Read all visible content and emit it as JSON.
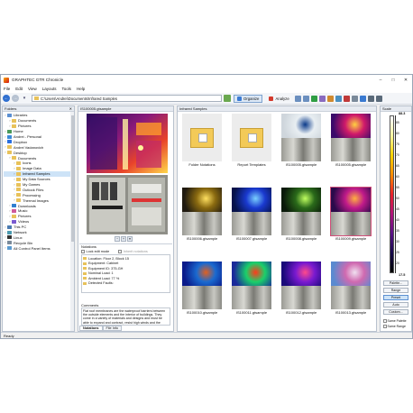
{
  "window": {
    "title": "GRAPHTEC GTR Chronicle"
  },
  "menu": [
    "File",
    "Edit",
    "View",
    "Layouts",
    "Tools",
    "Help"
  ],
  "address": {
    "path": "C:\\Users\\Andrei\\Documents\\Infrared Samples"
  },
  "toolbar": {
    "organize": "Organize",
    "analyze": "Analyze"
  },
  "folders": {
    "header": "Folders",
    "items": [
      {
        "label": "Libraries",
        "indent": 0,
        "icon": "library-icon"
      },
      {
        "label": "Documents",
        "indent": 1,
        "icon": "folder-icon"
      },
      {
        "label": "Pictures",
        "indent": 1,
        "icon": "folder-icon"
      },
      {
        "label": "Home",
        "indent": 0,
        "icon": "home-icon"
      },
      {
        "label": "Andrei - Personal",
        "indent": 0,
        "icon": "cloud-icon"
      },
      {
        "label": "Dropbox",
        "indent": 0,
        "icon": "dropbox-icon"
      },
      {
        "label": "Andrei Vadanovich",
        "indent": 0,
        "icon": "user-folder-icon"
      },
      {
        "label": "Desktop",
        "indent": 0,
        "icon": "folder-icon"
      },
      {
        "label": "Documents",
        "indent": 1,
        "icon": "folder-icon"
      },
      {
        "label": "Icons",
        "indent": 2,
        "icon": "folder-icon"
      },
      {
        "label": "Image Data",
        "indent": 2,
        "icon": "folder-icon"
      },
      {
        "label": "Infrared Samples",
        "indent": 2,
        "icon": "folder-icon",
        "selected": true
      },
      {
        "label": "My Data Sources",
        "indent": 2,
        "icon": "folder-icon"
      },
      {
        "label": "My Games",
        "indent": 2,
        "icon": "folder-icon"
      },
      {
        "label": "Outlook Files",
        "indent": 2,
        "icon": "folder-icon"
      },
      {
        "label": "Processing",
        "indent": 2,
        "icon": "folder-icon"
      },
      {
        "label": "Thermal Images",
        "indent": 2,
        "icon": "folder-icon"
      },
      {
        "label": "Downloads",
        "indent": 1,
        "icon": "download-icon"
      },
      {
        "label": "Music",
        "indent": 1,
        "icon": "music-icon"
      },
      {
        "label": "Pictures",
        "indent": 1,
        "icon": "folder-icon"
      },
      {
        "label": "Videos",
        "indent": 1,
        "icon": "video-icon"
      },
      {
        "label": "This PC",
        "indent": 0,
        "icon": "pc-icon"
      },
      {
        "label": "Network",
        "indent": 0,
        "icon": "network-icon"
      },
      {
        "label": "Linux",
        "indent": 0,
        "icon": "linux-icon"
      },
      {
        "label": "Recycle Bin",
        "indent": 0,
        "icon": "recycle-bin-icon"
      },
      {
        "label": "All Control Panel Items",
        "indent": 0,
        "icon": "control-panel-icon"
      }
    ]
  },
  "preview": {
    "header": "IS100005.gtsample",
    "notations": {
      "header": "Notations",
      "lock_label": "Lock edit mode",
      "inherit_label": "Inherit notations",
      "items": [
        "Location: Floor 2, Block 15",
        "Equipment: Cabinet",
        "Equipment ID: 375-GH",
        "Nominal Load: 1",
        "Ambient Load: 77 %",
        "Detected Faults:"
      ]
    },
    "comments": {
      "header": "Comments",
      "text": "Flat roof membranes are the waterproof barriers between the outside elements and the interior of buildings. They come in a variety of materials and designs and must be able to expand and contract, resist high winds and the effects of solar radiation and withstand foot traffic. It is easy to see why roofs leak..."
    },
    "tabs": [
      "Notations",
      "File Info"
    ]
  },
  "thumbs": {
    "header": "Infrared Samples",
    "items": [
      {
        "label": "Folder Notations",
        "kind": "folder"
      },
      {
        "label": "Report Templates",
        "kind": "folder"
      },
      {
        "label": "IS100005.gtsample",
        "kind": "ir",
        "scheme": "whitepanel"
      },
      {
        "label": "IS100005.gtsample",
        "kind": "ir",
        "scheme": "purple"
      },
      {
        "label": "IS100006.gtsample",
        "kind": "ir",
        "scheme": "yellowdark"
      },
      {
        "label": "IS100007.gtsample",
        "kind": "ir",
        "scheme": "blue"
      },
      {
        "label": "IS100008.gtsample",
        "kind": "ir",
        "scheme": "green"
      },
      {
        "label": "IS100009.gtsample",
        "kind": "ir",
        "scheme": "magenta",
        "selected": true
      },
      {
        "label": "IS100010.gtsample",
        "kind": "ir",
        "scheme": "bluepanel"
      },
      {
        "label": "IS100011.gtsample",
        "kind": "ir",
        "scheme": "rainbow"
      },
      {
        "label": "IS100012.gtsample",
        "kind": "ir",
        "scheme": "purplepanel"
      },
      {
        "label": "IS100013.gtsample",
        "kind": "ir",
        "scheme": "pinkpanel"
      }
    ]
  },
  "palette": {
    "header": "Scale",
    "max": "88.3",
    "min": "17.5",
    "ticks": [
      "85",
      "80",
      "75",
      "70",
      "65",
      "60",
      "55",
      "50",
      "45",
      "40",
      "35",
      "30",
      "25",
      "20"
    ],
    "buttons": [
      "Palette...",
      "Range",
      "Preset",
      "Auto",
      "Custom..."
    ],
    "active_button": "Preset",
    "checks": [
      "Same Palette",
      "Same Range"
    ]
  },
  "status": {
    "text": "Ready"
  },
  "colors": {
    "accent": "#2f6fd0",
    "selection": "#cde3f7",
    "thumb_select": "#d14f7a"
  }
}
